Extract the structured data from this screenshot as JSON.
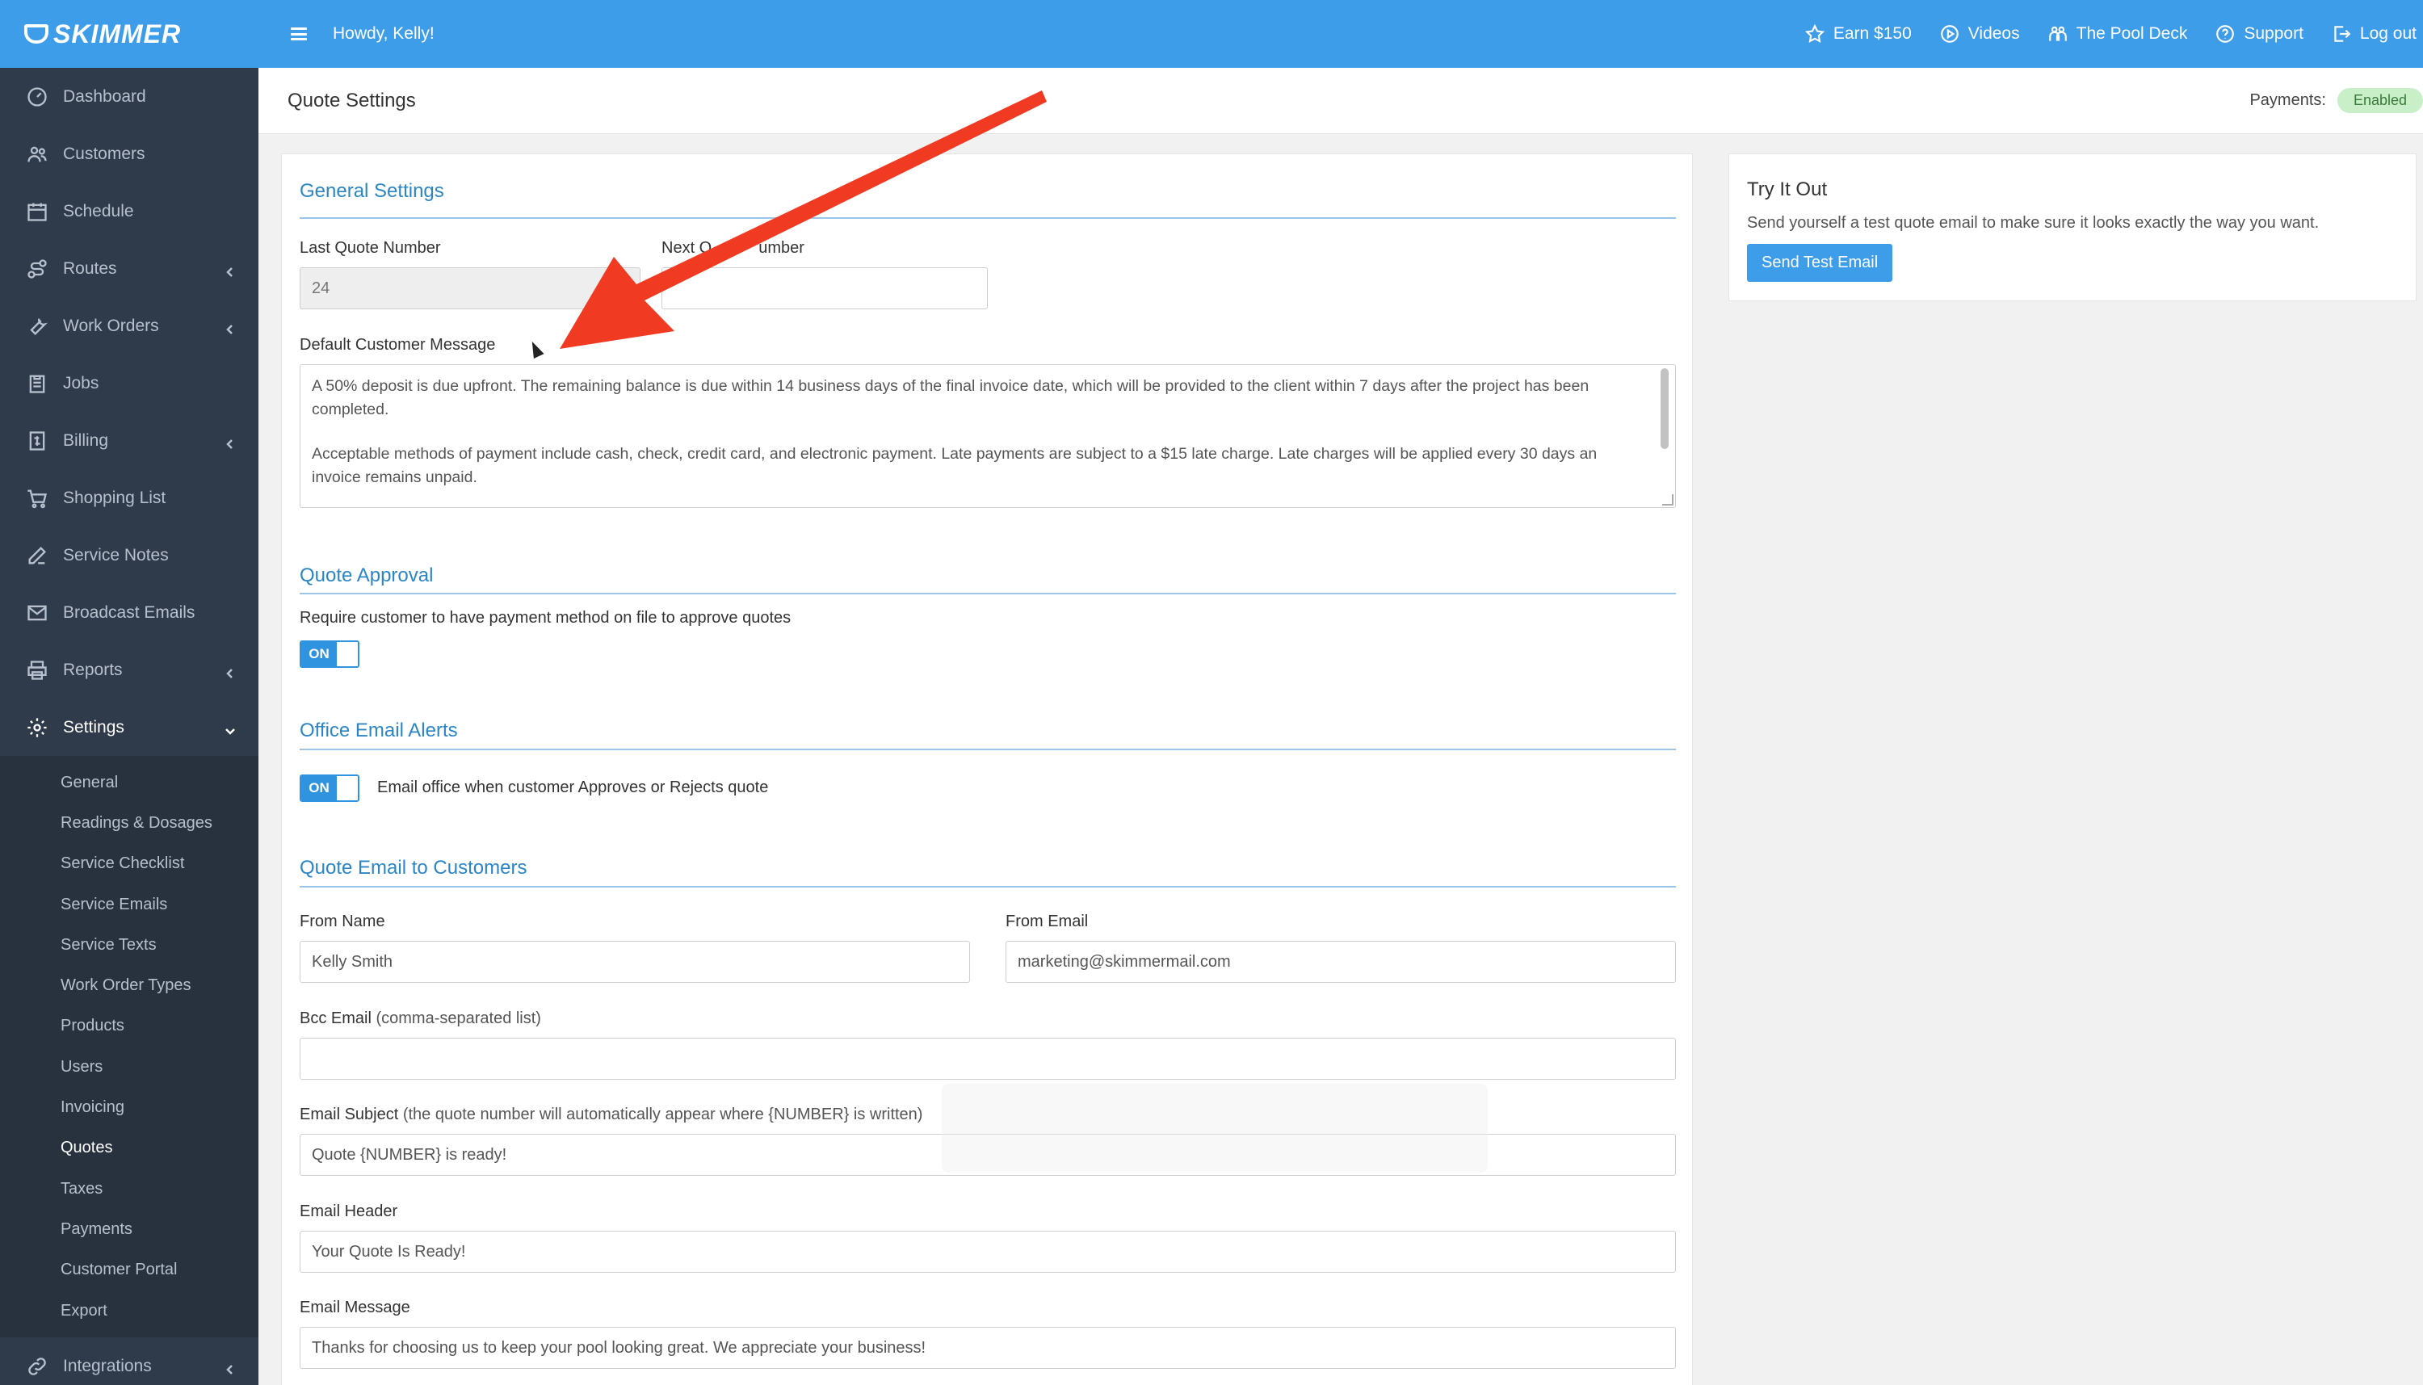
{
  "brand": {
    "logo_text": "SKIMMER",
    "accent": "#3d9de9"
  },
  "topbar": {
    "greeting": "Howdy, Kelly!",
    "links": [
      {
        "label": "Earn $150",
        "icon": "star-icon"
      },
      {
        "label": "Videos",
        "icon": "play-icon"
      },
      {
        "label": "The Pool Deck",
        "icon": "community-icon"
      },
      {
        "label": "Support",
        "icon": "help-icon"
      },
      {
        "label": "Log out",
        "icon": "logout-icon"
      }
    ]
  },
  "sidebar": {
    "items": [
      {
        "label": "Dashboard",
        "icon": "dashboard-icon"
      },
      {
        "label": "Customers",
        "icon": "customers-icon"
      },
      {
        "label": "Schedule",
        "icon": "calendar-icon"
      },
      {
        "label": "Routes",
        "icon": "routes-icon"
      },
      {
        "label": "Work Orders",
        "icon": "wrench-icon"
      },
      {
        "label": "Jobs",
        "icon": "clipboard-icon"
      },
      {
        "label": "Billing",
        "icon": "billing-icon"
      },
      {
        "label": "Shopping List",
        "icon": "cart-icon"
      },
      {
        "label": "Service Notes",
        "icon": "edit-icon"
      },
      {
        "label": "Broadcast Emails",
        "icon": "mail-icon"
      },
      {
        "label": "Reports",
        "icon": "printer-icon"
      },
      {
        "label": "Settings",
        "icon": "gear-icon"
      },
      {
        "label": "Integrations",
        "icon": "link-icon"
      }
    ],
    "settings_sub": [
      "General",
      "Readings & Dosages",
      "Service Checklist",
      "Service Emails",
      "Service Texts",
      "Work Order Types",
      "Products",
      "Users",
      "Invoicing",
      "Quotes",
      "Taxes",
      "Payments",
      "Customer Portal",
      "Export"
    ]
  },
  "header": {
    "title": "Quote Settings",
    "payments_label": "Payments:",
    "payments_status": "Enabled"
  },
  "general": {
    "title": "General Settings",
    "last_quote_label": "Last Quote Number",
    "last_quote_value": "24",
    "next_quote_label_a": "Next Q",
    "next_quote_label_b": "umber",
    "default_msg_label": "Default Customer Message",
    "default_msg_p1": "A 50% deposit is due upfront. The remaining balance is due within 14 business days of the final invoice date, which will be provided to the client within 7 days after the project has been completed.",
    "default_msg_p2": "Acceptable methods of payment include cash, check, credit card, and electronic payment. Late payments are subject to a $15 late charge. Late charges will be applied every 30 days an invoice remains unpaid."
  },
  "approval": {
    "title": "Quote Approval",
    "require_label": "Require customer to have payment method on file to approve quotes",
    "toggle": "ON"
  },
  "alerts": {
    "title": "Office Email Alerts",
    "toggle": "ON",
    "label": "Email office when customer Approves or Rejects quote"
  },
  "email": {
    "title": "Quote Email to Customers",
    "from_name_label": "From Name",
    "from_name_value": "Kelly Smith",
    "from_email_label": "From Email",
    "from_email_value": "marketing@skimmermail.com",
    "bcc_label": "Bcc Email",
    "bcc_hint": "(comma-separated list)",
    "bcc_value": "",
    "subject_label": "Email Subject",
    "subject_hint": "(the quote number will automatically appear where {NUMBER} is written)",
    "subject_value": "Quote {NUMBER} is ready!",
    "header_label": "Email Header",
    "header_value": "Your Quote Is Ready!",
    "message_label": "Email Message",
    "message_value": "Thanks for choosing us to keep your pool looking great. We appreciate your business!"
  },
  "try_it": {
    "title": "Try It Out",
    "text": "Send yourself a test quote email to make sure it looks exactly the way you want.",
    "button": "Send Test Email"
  }
}
